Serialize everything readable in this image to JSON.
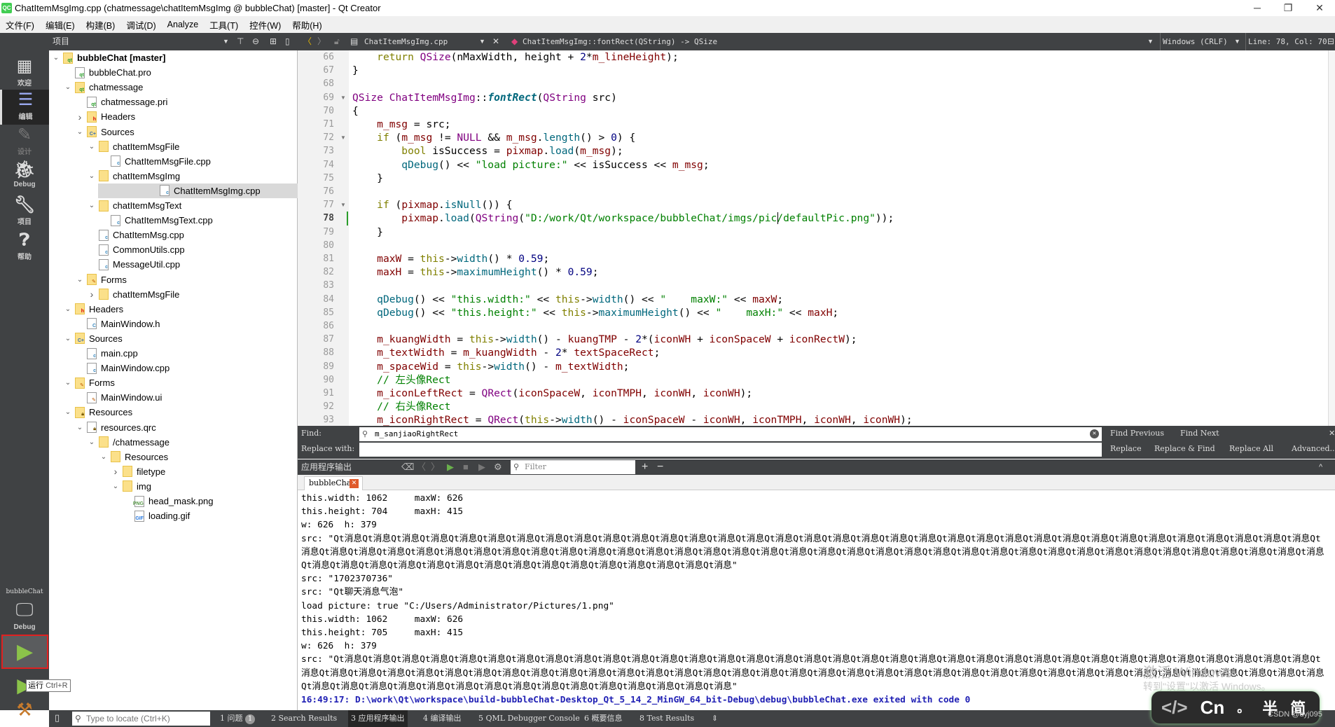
{
  "window": {
    "title": "ChatItemMsgImg.cpp (chatmessage\\chatItemMsgImg @ bubbleChat) [master] - Qt Creator",
    "logo": "QC",
    "minimize": "─",
    "restore": "❐",
    "close": "✕"
  },
  "menu": [
    "文件(F)",
    "编辑(E)",
    "构建(B)",
    "调试(D)",
    "Analyze",
    "工具(T)",
    "控件(W)",
    "帮助(H)"
  ],
  "project_panel": {
    "title": "项目"
  },
  "editor_toolbar": {
    "file": "ChatItemMsgImg.cpp",
    "symbol": "ChatItemMsgImg::fontRect(QString) -> QSize",
    "line_ending": "Windows (CRLF)",
    "position": "Line: 78, Col: 70"
  },
  "modes": [
    {
      "label": "欢迎",
      "icon": "grid-icon"
    },
    {
      "label": "编辑",
      "icon": "edit-icon",
      "selected": true
    },
    {
      "label": "设计",
      "icon": "pencil-icon",
      "disabled": true
    },
    {
      "label": "Debug",
      "icon": "bug-icon"
    },
    {
      "label": "项目",
      "icon": "wrench-icon"
    },
    {
      "label": "帮助",
      "icon": "help-icon"
    }
  ],
  "kit": {
    "project": "bubbleChat",
    "build": "Debug",
    "run_tooltip": "运行",
    "run_shortcut": "Ctrl+R"
  },
  "tree": [
    {
      "d": 0,
      "label": "bubbleChat [master]",
      "icon": "qt-folder",
      "arrow": "open",
      "bold": true
    },
    {
      "d": 1,
      "label": "bubbleChat.pro",
      "icon": "qt-file"
    },
    {
      "d": 1,
      "label": "chatmessage",
      "icon": "qt-folder",
      "arrow": "open"
    },
    {
      "d": 2,
      "label": "chatmessage.pri",
      "icon": "qt-file"
    },
    {
      "d": 2,
      "label": "Headers",
      "icon": "h-folder",
      "arrow": "closed"
    },
    {
      "d": 2,
      "label": "Sources",
      "icon": "cpp-folder",
      "arrow": "open"
    },
    {
      "d": 3,
      "label": "chatItemMsgFile",
      "icon": "folder",
      "arrow": "open"
    },
    {
      "d": 4,
      "label": "ChatItemMsgFile.cpp",
      "icon": "cpp-file"
    },
    {
      "d": 3,
      "label": "chatItemMsgImg",
      "icon": "folder",
      "arrow": "open"
    },
    {
      "d": 4,
      "label": "ChatItemMsgImg.cpp",
      "icon": "cpp-file",
      "selected": true
    },
    {
      "d": 3,
      "label": "chatItemMsgText",
      "icon": "folder",
      "arrow": "open"
    },
    {
      "d": 4,
      "label": "ChatItemMsgText.cpp",
      "icon": "cpp-file"
    },
    {
      "d": 3,
      "label": "ChatItemMsg.cpp",
      "icon": "cpp-file"
    },
    {
      "d": 3,
      "label": "CommonUtils.cpp",
      "icon": "cpp-file"
    },
    {
      "d": 3,
      "label": "MessageUtil.cpp",
      "icon": "cpp-file"
    },
    {
      "d": 2,
      "label": "Forms",
      "icon": "form-folder",
      "arrow": "open"
    },
    {
      "d": 3,
      "label": "chatItemMsgFile",
      "icon": "folder",
      "arrow": "closed"
    },
    {
      "d": 1,
      "label": "Headers",
      "icon": "h-folder",
      "arrow": "open"
    },
    {
      "d": 2,
      "label": "MainWindow.h",
      "icon": "h-file"
    },
    {
      "d": 1,
      "label": "Sources",
      "icon": "cpp-folder",
      "arrow": "open"
    },
    {
      "d": 2,
      "label": "main.cpp",
      "icon": "cpp-file"
    },
    {
      "d": 2,
      "label": "MainWindow.cpp",
      "icon": "cpp-file"
    },
    {
      "d": 1,
      "label": "Forms",
      "icon": "form-folder",
      "arrow": "open"
    },
    {
      "d": 2,
      "label": "MainWindow.ui",
      "icon": "ui-file"
    },
    {
      "d": 1,
      "label": "Resources",
      "icon": "res-folder",
      "arrow": "open"
    },
    {
      "d": 2,
      "label": "resources.qrc",
      "icon": "qrc-file",
      "arrow": "open"
    },
    {
      "d": 3,
      "label": "/chatmessage",
      "icon": "folder",
      "arrow": "open"
    },
    {
      "d": 4,
      "label": "Resources",
      "icon": "folder",
      "arrow": "open"
    },
    {
      "d": 5,
      "label": "filetype",
      "icon": "folder",
      "arrow": "closed"
    },
    {
      "d": 5,
      "label": "img",
      "icon": "folder",
      "arrow": "open"
    },
    {
      "d": 6,
      "label": "head_mask.png",
      "icon": "png-file"
    },
    {
      "d": 6,
      "label": "loading.gif",
      "icon": "gif-file"
    }
  ],
  "code": {
    "current_line": 78,
    "lines": [
      {
        "n": 66,
        "t": [
          [
            "p",
            "    "
          ],
          [
            "k",
            "return"
          ],
          [
            "p",
            " "
          ],
          [
            "t",
            "QSize"
          ],
          [
            "p",
            "(nMaxWidth, height + "
          ],
          [
            "n",
            "2"
          ],
          [
            "p",
            "*"
          ],
          [
            "m",
            "m_lineHeight"
          ],
          [
            "p",
            ");"
          ]
        ]
      },
      {
        "n": 67,
        "t": [
          [
            "p",
            "}"
          ]
        ]
      },
      {
        "n": 68,
        "t": []
      },
      {
        "n": 69,
        "fold": true,
        "t": [
          [
            "t",
            "QSize"
          ],
          [
            "p",
            " "
          ],
          [
            "t",
            "ChatItemMsgImg"
          ],
          [
            "p",
            "::"
          ],
          [
            "fd",
            "fontRect"
          ],
          [
            "p",
            "("
          ],
          [
            "t",
            "QString"
          ],
          [
            "p",
            " src)"
          ]
        ]
      },
      {
        "n": 70,
        "t": [
          [
            "p",
            "{"
          ]
        ]
      },
      {
        "n": 71,
        "t": [
          [
            "p",
            "    "
          ],
          [
            "m",
            "m_msg"
          ],
          [
            "p",
            " = src;"
          ]
        ]
      },
      {
        "n": 72,
        "fold": true,
        "t": [
          [
            "p",
            "    "
          ],
          [
            "k",
            "if"
          ],
          [
            "p",
            " ("
          ],
          [
            "m",
            "m_msg"
          ],
          [
            "p",
            " != "
          ],
          [
            "t",
            "NULL"
          ],
          [
            "p",
            " && "
          ],
          [
            "m",
            "m_msg"
          ],
          [
            "p",
            "."
          ],
          [
            "f",
            "length"
          ],
          [
            "p",
            "() > "
          ],
          [
            "n",
            "0"
          ],
          [
            "p",
            ") {"
          ]
        ]
      },
      {
        "n": 73,
        "t": [
          [
            "p",
            "        "
          ],
          [
            "k",
            "bool"
          ],
          [
            "p",
            " isSuccess = "
          ],
          [
            "m",
            "pixmap"
          ],
          [
            "p",
            "."
          ],
          [
            "f",
            "load"
          ],
          [
            "p",
            "("
          ],
          [
            "m",
            "m_msg"
          ],
          [
            "p",
            ");"
          ]
        ]
      },
      {
        "n": 74,
        "t": [
          [
            "p",
            "        "
          ],
          [
            "f",
            "qDebug"
          ],
          [
            "p",
            "() << "
          ],
          [
            "s",
            "\"load picture:\""
          ],
          [
            "p",
            " << isSuccess << "
          ],
          [
            "m",
            "m_msg"
          ],
          [
            "p",
            ";"
          ]
        ]
      },
      {
        "n": 75,
        "t": [
          [
            "p",
            "    }"
          ]
        ]
      },
      {
        "n": 76,
        "t": []
      },
      {
        "n": 77,
        "fold": true,
        "t": [
          [
            "p",
            "    "
          ],
          [
            "k",
            "if"
          ],
          [
            "p",
            " ("
          ],
          [
            "m",
            "pixmap"
          ],
          [
            "p",
            "."
          ],
          [
            "f",
            "isNull"
          ],
          [
            "p",
            "()) {"
          ]
        ]
      },
      {
        "n": 78,
        "t": [
          [
            "p",
            "        "
          ],
          [
            "m",
            "pixmap"
          ],
          [
            "p",
            "."
          ],
          [
            "f",
            "load"
          ],
          [
            "p",
            "("
          ],
          [
            "t",
            "QString"
          ],
          [
            "p",
            "("
          ],
          [
            "s",
            "\"D:/work/Qt/workspace/bubbleChat/imgs/pic/defaultPic.png\""
          ],
          [
            "p",
            "));"
          ]
        ]
      },
      {
        "n": 79,
        "t": [
          [
            "p",
            "    }"
          ]
        ]
      },
      {
        "n": 80,
        "t": []
      },
      {
        "n": 81,
        "t": [
          [
            "p",
            "    "
          ],
          [
            "m",
            "maxW"
          ],
          [
            "p",
            " = "
          ],
          [
            "k",
            "this"
          ],
          [
            "p",
            "->"
          ],
          [
            "f",
            "width"
          ],
          [
            "p",
            "() * "
          ],
          [
            "n",
            "0.59"
          ],
          [
            "p",
            ";"
          ]
        ]
      },
      {
        "n": 82,
        "t": [
          [
            "p",
            "    "
          ],
          [
            "m",
            "maxH"
          ],
          [
            "p",
            " = "
          ],
          [
            "k",
            "this"
          ],
          [
            "p",
            "->"
          ],
          [
            "f",
            "maximumHeight"
          ],
          [
            "p",
            "() * "
          ],
          [
            "n",
            "0.59"
          ],
          [
            "p",
            ";"
          ]
        ]
      },
      {
        "n": 83,
        "t": []
      },
      {
        "n": 84,
        "t": [
          [
            "p",
            "    "
          ],
          [
            "f",
            "qDebug"
          ],
          [
            "p",
            "() << "
          ],
          [
            "s",
            "\"this.width:\""
          ],
          [
            "p",
            " << "
          ],
          [
            "k",
            "this"
          ],
          [
            "p",
            "->"
          ],
          [
            "f",
            "width"
          ],
          [
            "p",
            "() << "
          ],
          [
            "s",
            "\"    maxW:\""
          ],
          [
            "p",
            " << "
          ],
          [
            "m",
            "maxW"
          ],
          [
            "p",
            ";"
          ]
        ]
      },
      {
        "n": 85,
        "t": [
          [
            "p",
            "    "
          ],
          [
            "f",
            "qDebug"
          ],
          [
            "p",
            "() << "
          ],
          [
            "s",
            "\"this.height:\""
          ],
          [
            "p",
            " << "
          ],
          [
            "k",
            "this"
          ],
          [
            "p",
            "->"
          ],
          [
            "f",
            "maximumHeight"
          ],
          [
            "p",
            "() << "
          ],
          [
            "s",
            "\"    maxH:\""
          ],
          [
            "p",
            " << "
          ],
          [
            "m",
            "maxH"
          ],
          [
            "p",
            ";"
          ]
        ]
      },
      {
        "n": 86,
        "t": []
      },
      {
        "n": 87,
        "t": [
          [
            "p",
            "    "
          ],
          [
            "m",
            "m_kuangWidth"
          ],
          [
            "p",
            " = "
          ],
          [
            "k",
            "this"
          ],
          [
            "p",
            "->"
          ],
          [
            "f",
            "width"
          ],
          [
            "p",
            "() - "
          ],
          [
            "m",
            "kuangTMP"
          ],
          [
            "p",
            " - "
          ],
          [
            "n",
            "2"
          ],
          [
            "p",
            "*("
          ],
          [
            "m",
            "iconWH"
          ],
          [
            "p",
            " + "
          ],
          [
            "m",
            "iconSpaceW"
          ],
          [
            "p",
            " + "
          ],
          [
            "m",
            "iconRectW"
          ],
          [
            "p",
            ");"
          ]
        ]
      },
      {
        "n": 88,
        "t": [
          [
            "p",
            "    "
          ],
          [
            "m",
            "m_textWidth"
          ],
          [
            "p",
            " = "
          ],
          [
            "m",
            "m_kuangWidth"
          ],
          [
            "p",
            " - "
          ],
          [
            "n",
            "2"
          ],
          [
            "p",
            "* "
          ],
          [
            "m",
            "textSpaceRect"
          ],
          [
            "p",
            ";"
          ]
        ]
      },
      {
        "n": 89,
        "t": [
          [
            "p",
            "    "
          ],
          [
            "m",
            "m_spaceWid"
          ],
          [
            "p",
            " = "
          ],
          [
            "k",
            "this"
          ],
          [
            "p",
            "->"
          ],
          [
            "f",
            "width"
          ],
          [
            "p",
            "() - "
          ],
          [
            "m",
            "m_textWidth"
          ],
          [
            "p",
            ";"
          ]
        ]
      },
      {
        "n": 90,
        "t": [
          [
            "p",
            "    "
          ],
          [
            "c",
            "// 左头像Rect"
          ]
        ]
      },
      {
        "n": 91,
        "t": [
          [
            "p",
            "    "
          ],
          [
            "m",
            "m_iconLeftRect"
          ],
          [
            "p",
            " = "
          ],
          [
            "t",
            "QRect"
          ],
          [
            "p",
            "("
          ],
          [
            "m",
            "iconSpaceW"
          ],
          [
            "p",
            ", "
          ],
          [
            "m",
            "iconTMPH"
          ],
          [
            "p",
            ", "
          ],
          [
            "m",
            "iconWH"
          ],
          [
            "p",
            ", "
          ],
          [
            "m",
            "iconWH"
          ],
          [
            "p",
            ");"
          ]
        ]
      },
      {
        "n": 92,
        "t": [
          [
            "p",
            "    "
          ],
          [
            "c",
            "// 右头像Rect"
          ]
        ]
      },
      {
        "n": 93,
        "t": [
          [
            "p",
            "    "
          ],
          [
            "m",
            "m_iconRightRect"
          ],
          [
            "p",
            " = "
          ],
          [
            "t",
            "QRect"
          ],
          [
            "p",
            "("
          ],
          [
            "k",
            "this"
          ],
          [
            "p",
            "->"
          ],
          [
            "f",
            "width"
          ],
          [
            "p",
            "() - "
          ],
          [
            "m",
            "iconSpaceW"
          ],
          [
            "p",
            " - "
          ],
          [
            "m",
            "iconWH"
          ],
          [
            "p",
            ", "
          ],
          [
            "m",
            "iconTMPH"
          ],
          [
            "p",
            ", "
          ],
          [
            "m",
            "iconWH"
          ],
          [
            "p",
            ", "
          ],
          [
            "m",
            "iconWH"
          ],
          [
            "p",
            ");"
          ]
        ]
      }
    ]
  },
  "find": {
    "find_label": "Find:",
    "find_value": "m_sanjiaoRightRect",
    "replace_label": "Replace with:",
    "replace_value": "",
    "find_previous": "Find Previous",
    "find_next": "Find Next",
    "replace": "Replace",
    "replace_find": "Replace & Find",
    "replace_all": "Replace All",
    "advanced": "Advanced..."
  },
  "output": {
    "title": "应用程序输出",
    "filter_placeholder": "Filter",
    "tab": "bubbleChat",
    "lines": [
      "this.width: 1062     maxW: 626",
      "this.height: 704     maxH: 415",
      "w: 626  h: 379",
      "src: \"Qt消息Qt消息Qt消息Qt消息Qt消息Qt消息Qt消息Qt消息Qt消息Qt消息Qt消息Qt消息Qt消息Qt消息Qt消息Qt消息Qt消息Qt消息Qt消息Qt消息Qt消息Qt消息Qt消息Qt消息Qt消息Qt消息Qt消息Qt消息Qt消息Qt消息Qt消息Qt消息Qt消息Qt消息Qt消息Qt消息Qt消息Qt消息Qt消息Qt消息Qt消息Qt消息Qt消息Qt消息Qt消息Qt消息Qt消息Qt消息Qt消息Qt消息Qt消息Qt消息Qt消息Qt消息Qt消息Qt消息Qt消息Qt消息Qt消息Qt消息Qt消息Qt消息Qt消息Qt消息Qt消息Qt消息Qt消息Qt消息Qt消息Qt消息Qt消息Qt消息Qt消息Qt消息Qt消息Qt消息Qt消息Qt消息Qt消息Qt消息Qt消息Qt消息Qt消息Qt消息Qt消息\"",
      "src: \"1702370736\"",
      "src: \"Qt聊天消息气泡\"",
      "load picture: true \"C:/Users/Administrator/Pictures/1.png\"",
      "this.width: 1062     maxW: 626",
      "this.height: 705     maxH: 415",
      "w: 626  h: 379",
      "src: \"Qt消息Qt消息Qt消息Qt消息Qt消息Qt消息Qt消息Qt消息Qt消息Qt消息Qt消息Qt消息Qt消息Qt消息Qt消息Qt消息Qt消息Qt消息Qt消息Qt消息Qt消息Qt消息Qt消息Qt消息Qt消息Qt消息Qt消息Qt消息Qt消息Qt消息Qt消息Qt消息Qt消息Qt消息Qt消息Qt消息Qt消息Qt消息Qt消息Qt消息Qt消息Qt消息Qt消息Qt消息Qt消息Qt消息Qt消息Qt消息Qt消息Qt消息Qt消息Qt消息Qt消息Qt消息Qt消息Qt消息Qt消息Qt消息Qt消息Qt消息Qt消息Qt消息Qt消息Qt消息Qt消息Qt消息Qt消息Qt消息Qt消息Qt消息Qt消息Qt消息Qt消息Qt消息Qt消息Qt消息Qt消息Qt消息Qt消息Qt消息Qt消息Qt消息Qt消息Qt消息Qt消息\""
    ],
    "exit_line": "16:49:17: D:\\work\\Qt\\workspace\\build-bubbleChat-Desktop_Qt_5_14_2_MinGW_64_bit-Debug\\debug\\bubbleChat.exe exited with code 0"
  },
  "statusbar": {
    "locate_placeholder": "Type to locate (Ctrl+K)",
    "issues_badge": "1",
    "items": [
      "1 问题",
      "2 Search Results",
      "3 应用程序输出",
      "4 编译输出",
      "5 QML Debugger Console",
      "6 概要信息",
      "8 Test Results"
    ]
  },
  "overlay": {
    "activate_title": "激活 Windows",
    "activate_sub": "转到\"设置\"以激活 Windows。",
    "ime": [
      "</>",
      "Cn",
      "。",
      "半",
      "简"
    ],
    "csdn": "CSDN @dyj095"
  }
}
